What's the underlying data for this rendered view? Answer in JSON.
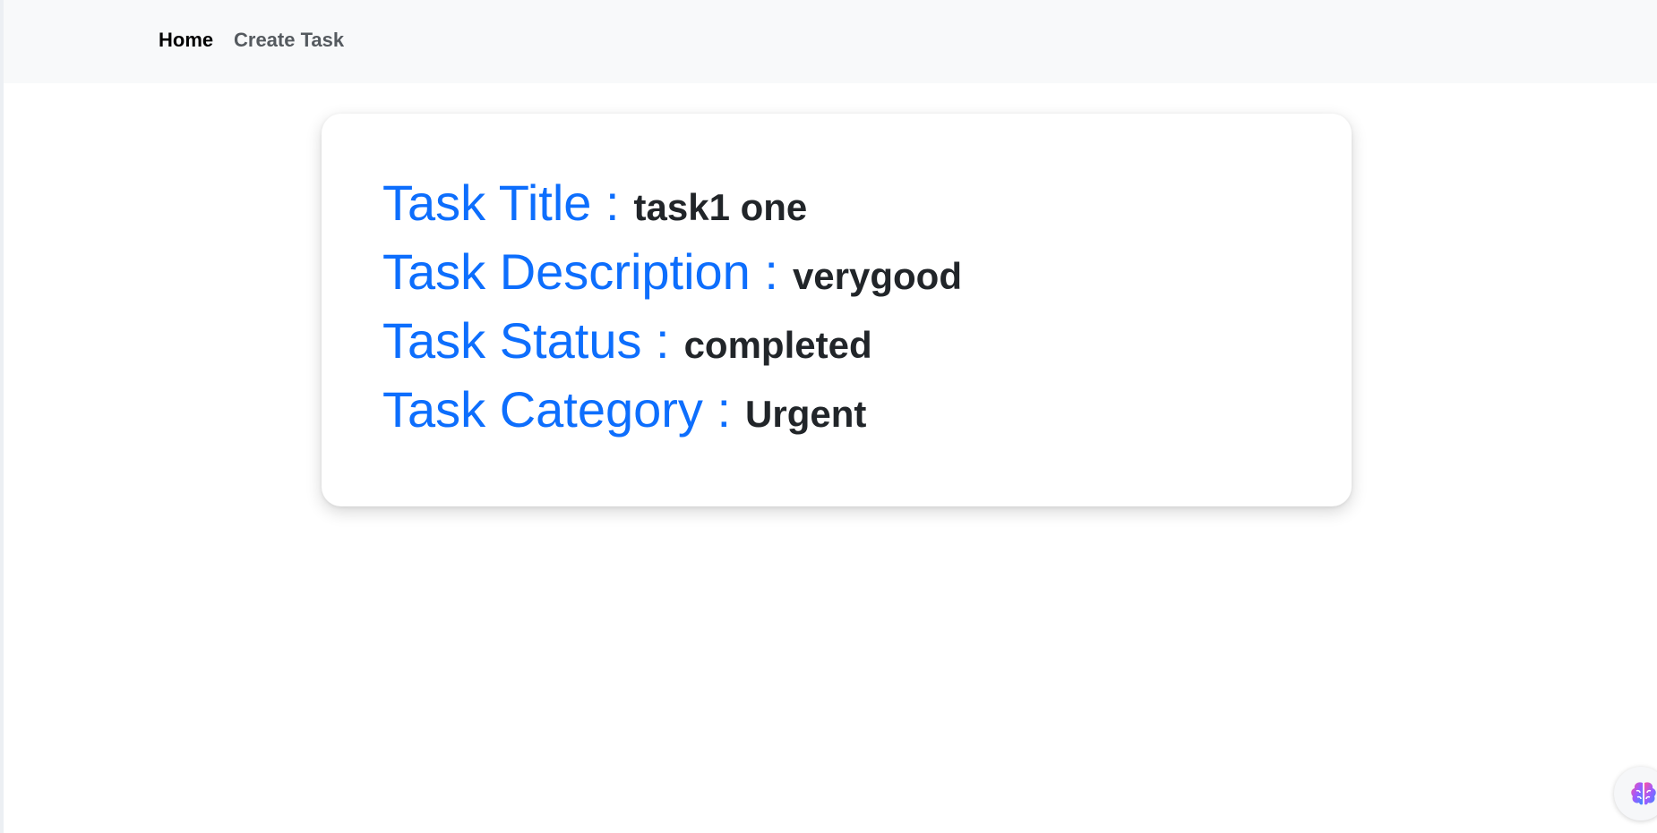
{
  "nav": {
    "home_label": "Home",
    "create_task_label": "Create Task"
  },
  "task": {
    "title_label": "Task Title :",
    "title_value": "task1 one",
    "description_label": "Task Description :",
    "description_value": "verygood",
    "status_label": "Task Status :",
    "status_value": "completed",
    "category_label": "Task Category :",
    "category_value": "Urgent"
  },
  "floating_button": {
    "icon": "brain-icon"
  },
  "colors": {
    "label": "#0d6efd",
    "value": "#212529",
    "navbar_bg": "#f8f9fa"
  }
}
